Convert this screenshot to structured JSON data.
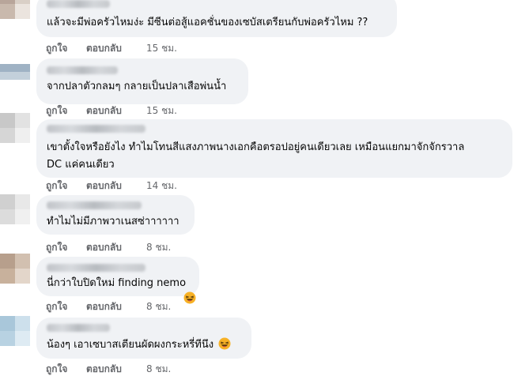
{
  "actions": {
    "like_label": "ถูกใจ",
    "reply_label": "ตอบกลับ"
  },
  "comments": [
    {
      "text": "แล้วจะมีพ่อครัวไหมง่ะ มีซีนต่อสู้แอคชั่นของเซบัสเตรียนกับพ่อครัวไหม ??",
      "time": "15 ชม."
    },
    {
      "text": "จากปลาตัวกลมๆ กลายเป็นปลาเสือพ่นน้ำ",
      "time": "15 ชม."
    },
    {
      "text_line1": "เขาตั้งใจหรือยังไง ทำไมโทนสีแสงภาพนางเอกคือตรอปอยู่คนเดียวเลย เหมือนแยกมาจักจักรวาล",
      "text_line2": "DC แค่คนเดียว",
      "time": "14 ชม."
    },
    {
      "text": "ทำไมไม่มีภาพวาเนสซ่าาาาาา",
      "time": "8 ชม."
    },
    {
      "text": "นี่กว่าใบปิดใหม่ finding nemo",
      "time": "8 ชม.",
      "reaction_icon": "laughing-emoji"
    },
    {
      "text": "น้องๆ เอาเซบาสเตียนผัดผงกระหรี่ทีนึง",
      "time": "8 ชม.",
      "emoji": "laughing-emoji"
    }
  ],
  "colors": {
    "bubble": "#f0f2f5",
    "text": "#050505",
    "meta": "#65676b",
    "emoji": "#f7b125"
  }
}
